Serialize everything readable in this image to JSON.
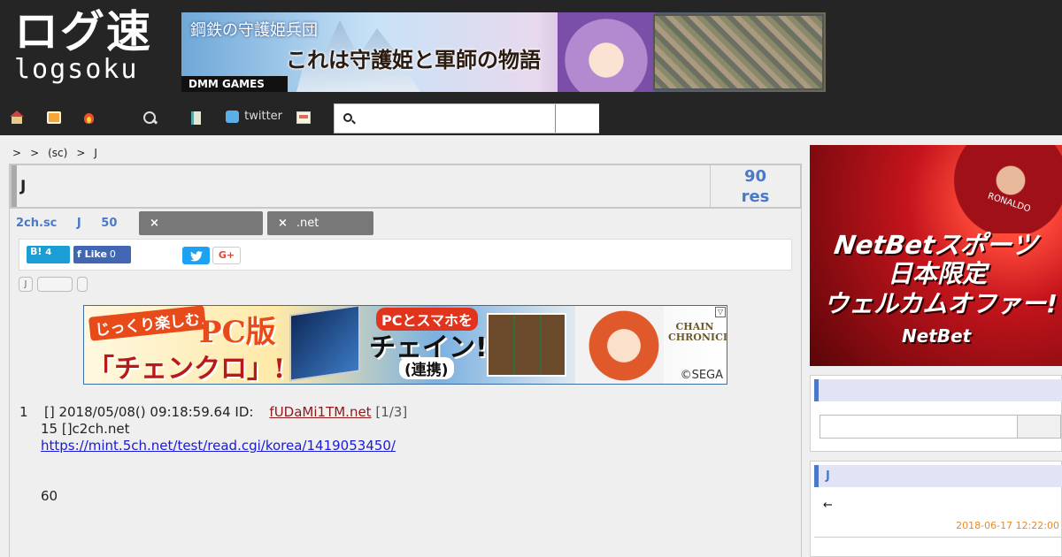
{
  "header": {
    "logo_jp": "ログ速",
    "logo_en": "logsoku",
    "top_banner": {
      "title": "鋼鉄の守護姫兵団",
      "headline": "これは守護姫と軍師の物語",
      "brand": "DMM GAMES"
    },
    "nav": {
      "twitter_label": "twitter"
    },
    "search": {
      "placeholder": "",
      "value": ""
    }
  },
  "breadcrumb": [
    ">",
    ">",
    "(sc)",
    ">",
    "J"
  ],
  "thread": {
    "title": "J",
    "res_count": "90",
    "res_label": "res",
    "meta_source": "2ch.sc",
    "meta_board": "J",
    "meta_count": "50",
    "tags": [
      {
        "label": ""
      },
      {
        "label": ".net"
      }
    ],
    "tag_close": "×"
  },
  "share": {
    "hatena_label": "B!",
    "hatena_count": "4",
    "fb_label": "Like",
    "fb_count": "0",
    "gplus_label": "G+"
  },
  "mini_buttons": [
    "J",
    "",
    ""
  ],
  "mid_banner": {
    "tagline": "じっくり楽しむ",
    "title": "PC版",
    "name": "「チェンクロ」!",
    "bubble": "PCとスマホを",
    "chain": "チェイン!",
    "sub": "(連携)",
    "brand": "CHAIN CHRONICLE",
    "copyright": "©SEGA"
  },
  "post": {
    "num": "1",
    "header": "[] 2018/05/08() 09:18:59.64 ID:",
    "id_link": "fUDaMi1TM.net",
    "id_count": "[1/3]",
    "body_line1": "15 []c2ch.net",
    "url": "https://mint.5ch.net/test/read.cgi/korea/1419053450/",
    "body_line2": "60"
  },
  "sidebar": {
    "ad": {
      "line1": "NetBetスポーツ",
      "line2": "日本限定",
      "line3": "ウェルカムオファー!",
      "line4": "NetBet",
      "jersey": "RONALDO"
    },
    "search_panel": {
      "header": "",
      "input_value": ""
    },
    "related_panel": {
      "header": "J",
      "arrow": "←",
      "date": "2018-06-17 12:22:00"
    }
  },
  "colors": {
    "header_bg": "#252525",
    "accent_blue": "#4a79c8",
    "link_red": "#8b1a1a",
    "date_orange": "#e38a2e"
  }
}
